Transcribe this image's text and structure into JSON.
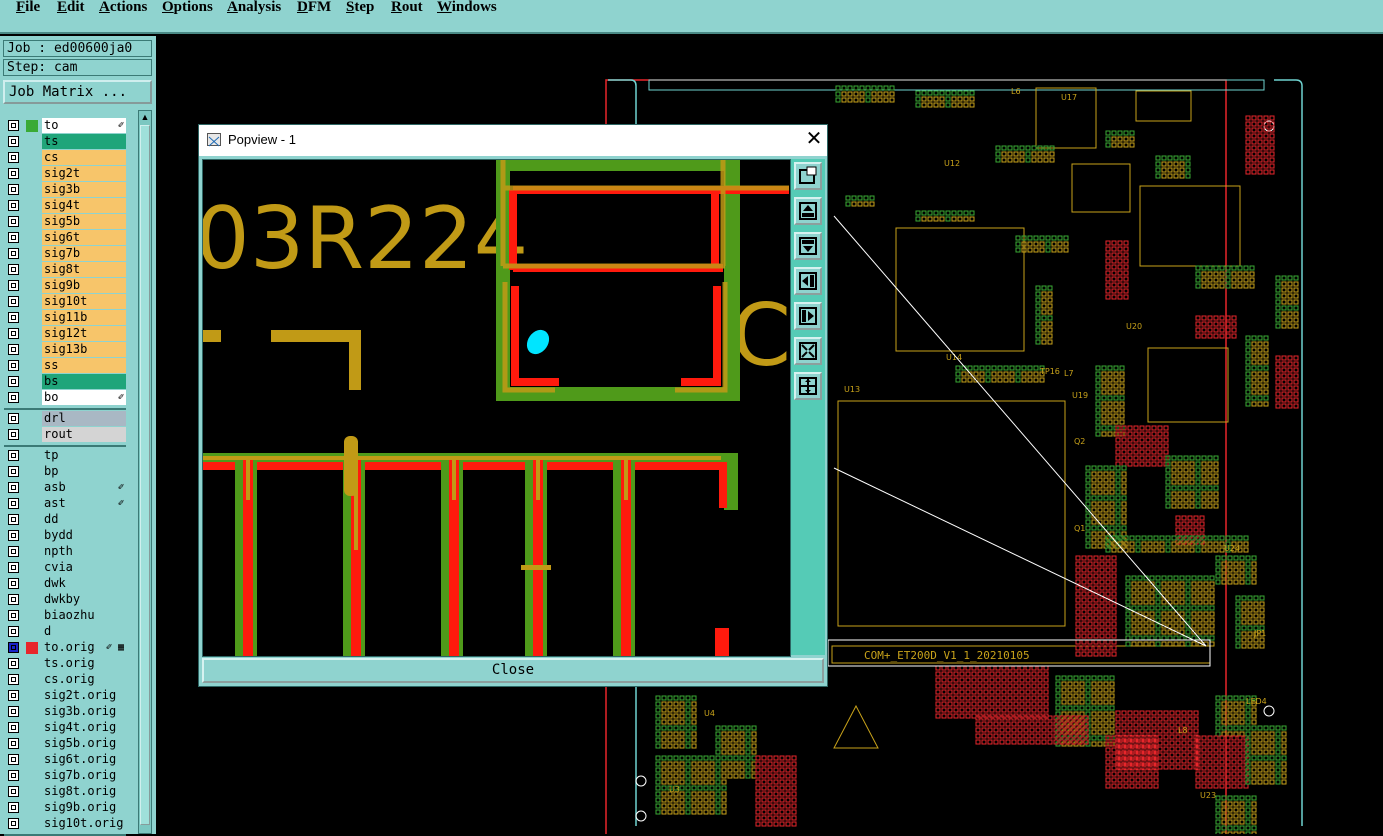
{
  "menu": [
    "File",
    "Edit",
    "Actions",
    "Options",
    "Analysis",
    "DFM",
    "Step",
    "Rout",
    "Windows"
  ],
  "job_label": "Job : ed00600ja0",
  "step_label": "Step: cam",
  "job_matrix_label": "Job Matrix ...",
  "layer_groups": [
    [
      {
        "name": "to",
        "color": "#ffffff",
        "chip": "#3aaa35",
        "mark": "✐"
      },
      {
        "name": "ts",
        "color": "#1fa57a",
        "chip": "",
        "mark": ""
      },
      {
        "name": "cs",
        "color": "#f7c56a",
        "chip": "",
        "mark": ""
      },
      {
        "name": "sig2t",
        "color": "#f7c56a",
        "chip": "",
        "mark": ""
      },
      {
        "name": "sig3b",
        "color": "#f7c56a",
        "chip": "",
        "mark": ""
      },
      {
        "name": "sig4t",
        "color": "#f7c56a",
        "chip": "",
        "mark": ""
      },
      {
        "name": "sig5b",
        "color": "#f7c56a",
        "chip": "",
        "mark": ""
      },
      {
        "name": "sig6t",
        "color": "#f7c56a",
        "chip": "",
        "mark": ""
      },
      {
        "name": "sig7b",
        "color": "#f7c56a",
        "chip": "",
        "mark": ""
      },
      {
        "name": "sig8t",
        "color": "#f7c56a",
        "chip": "",
        "mark": ""
      },
      {
        "name": "sig9b",
        "color": "#f7c56a",
        "chip": "",
        "mark": ""
      },
      {
        "name": "sig10t",
        "color": "#f7c56a",
        "chip": "",
        "mark": ""
      },
      {
        "name": "sig11b",
        "color": "#f7c56a",
        "chip": "",
        "mark": ""
      },
      {
        "name": "sig12t",
        "color": "#f7c56a",
        "chip": "",
        "mark": ""
      },
      {
        "name": "sig13b",
        "color": "#f7c56a",
        "chip": "",
        "mark": ""
      },
      {
        "name": "ss",
        "color": "#f7c56a",
        "chip": "",
        "mark": ""
      },
      {
        "name": "bs",
        "color": "#1fa57a",
        "chip": "",
        "mark": ""
      },
      {
        "name": "bo",
        "color": "#ffffff",
        "chip": "",
        "mark": "✐"
      }
    ],
    [
      {
        "name": "drl",
        "color": "#a9b8c4",
        "chip": "",
        "mark": ""
      },
      {
        "name": "rout",
        "color": "#d4d4d4",
        "chip": "",
        "mark": ""
      }
    ],
    [
      {
        "name": "tp",
        "color": "#8fd3cf",
        "chip": "",
        "mark": ""
      },
      {
        "name": "bp",
        "color": "#8fd3cf",
        "chip": "",
        "mark": ""
      },
      {
        "name": "asb",
        "color": "#8fd3cf",
        "chip": "",
        "mark": "✐"
      },
      {
        "name": "ast",
        "color": "#8fd3cf",
        "chip": "",
        "mark": "✐"
      },
      {
        "name": "dd",
        "color": "#8fd3cf",
        "chip": "",
        "mark": ""
      },
      {
        "name": "bydd",
        "color": "#8fd3cf",
        "chip": "",
        "mark": ""
      },
      {
        "name": "npth",
        "color": "#8fd3cf",
        "chip": "",
        "mark": ""
      },
      {
        "name": "cvia",
        "color": "#8fd3cf",
        "chip": "",
        "mark": ""
      },
      {
        "name": "dwk",
        "color": "#8fd3cf",
        "chip": "",
        "mark": ""
      },
      {
        "name": "dwkby",
        "color": "#8fd3cf",
        "chip": "",
        "mark": ""
      },
      {
        "name": "biaozhu",
        "color": "#8fd3cf",
        "chip": "",
        "mark": ""
      },
      {
        "name": "d",
        "color": "#8fd3cf",
        "chip": "",
        "mark": ""
      },
      {
        "name": "to.orig",
        "color": "#8fd3cf",
        "chip": "#e8262b",
        "mark": "✐ ▦",
        "active": true
      },
      {
        "name": "ts.orig",
        "color": "#8fd3cf",
        "chip": "",
        "mark": ""
      },
      {
        "name": "cs.orig",
        "color": "#8fd3cf",
        "chip": "",
        "mark": ""
      },
      {
        "name": "sig2t.orig",
        "color": "#8fd3cf",
        "chip": "",
        "mark": ""
      },
      {
        "name": "sig3b.orig",
        "color": "#8fd3cf",
        "chip": "",
        "mark": ""
      },
      {
        "name": "sig4t.orig",
        "color": "#8fd3cf",
        "chip": "",
        "mark": ""
      },
      {
        "name": "sig5b.orig",
        "color": "#8fd3cf",
        "chip": "",
        "mark": ""
      },
      {
        "name": "sig6t.orig",
        "color": "#8fd3cf",
        "chip": "",
        "mark": ""
      },
      {
        "name": "sig7b.orig",
        "color": "#8fd3cf",
        "chip": "",
        "mark": ""
      },
      {
        "name": "sig8t.orig",
        "color": "#8fd3cf",
        "chip": "",
        "mark": ""
      },
      {
        "name": "sig9b.orig",
        "color": "#8fd3cf",
        "chip": "",
        "mark": ""
      },
      {
        "name": "sig10t.orig",
        "color": "#8fd3cf",
        "chip": "",
        "mark": ""
      }
    ]
  ],
  "popview": {
    "title": "Popview - 1",
    "close_label": "Close",
    "zoom_text": "03R224",
    "side_text": "C",
    "tool_icons": [
      "zoom-home-icon",
      "pan-up-icon",
      "pan-down-icon",
      "pan-left-icon",
      "pan-right-icon",
      "zoom-fit-icon",
      "zoom-in-out-icon"
    ]
  },
  "board": {
    "labels": [
      "U17",
      "U12",
      "U14",
      "U13",
      "U19",
      "U20",
      "U24",
      "L6",
      "L7",
      "L8",
      "Q1",
      "Q2",
      "U3",
      "U4",
      "U23",
      "LED4",
      "JP1",
      "TP16"
    ],
    "footer_text": "COM+_ET200D_V1_1_20210105"
  }
}
